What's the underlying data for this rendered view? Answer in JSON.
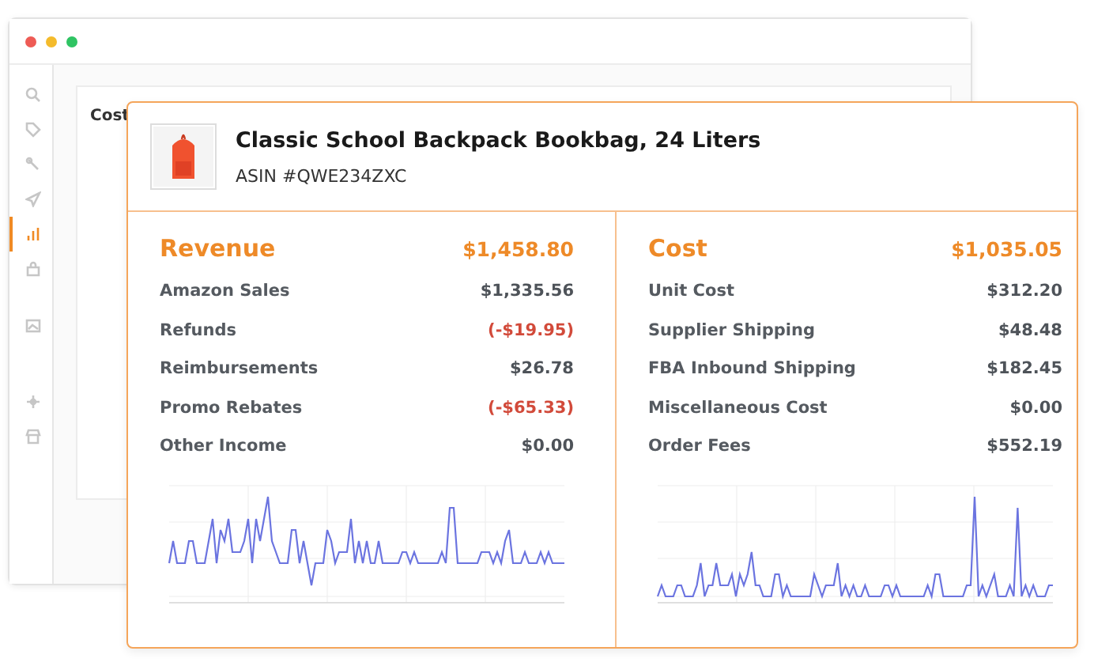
{
  "window": {
    "panel_title": "Cost"
  },
  "sidebar": {
    "items": [
      {
        "selected": false
      },
      {
        "selected": false
      },
      {
        "selected": false
      },
      {
        "selected": false
      },
      {
        "selected": true
      },
      {
        "selected": false
      },
      {
        "selected": false
      },
      {
        "selected": false
      },
      {
        "selected": false
      }
    ]
  },
  "product": {
    "title": "Classic School Backpack Bookbag, 24 Liters",
    "asin": "ASIN #QWE234ZXC"
  },
  "sections": [
    {
      "title": "Revenue",
      "total": "$1,458.80",
      "rows": [
        {
          "label": "Amazon Sales",
          "value": "$1,335.56",
          "negative": false
        },
        {
          "label": "Refunds",
          "value": "(-$19.95)",
          "negative": true
        },
        {
          "label": "Reimbursements",
          "value": "$26.78",
          "negative": false
        },
        {
          "label": "Promo Rebates",
          "value": "(-$65.33)",
          "negative": true
        },
        {
          "label": "Other Income",
          "value": "$0.00",
          "negative": false
        }
      ]
    },
    {
      "title": "Cost",
      "total": "$1,035.05",
      "rows": [
        {
          "label": "Unit Cost",
          "value": "$312.20",
          "negative": false
        },
        {
          "label": "Supplier Shipping",
          "value": "$48.48",
          "negative": false
        },
        {
          "label": "FBA Inbound Shipping",
          "value": "$182.45",
          "negative": false
        },
        {
          "label": "Miscellaneous Cost",
          "value": "$0.00",
          "negative": false
        },
        {
          "label": "Order Fees",
          "value": "$552.19",
          "negative": false
        }
      ]
    }
  ]
}
